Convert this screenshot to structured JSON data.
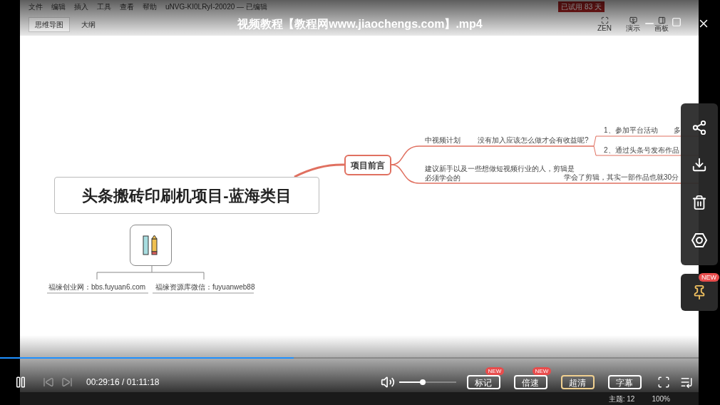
{
  "app": {
    "menu": [
      "文件",
      "编辑",
      "插入",
      "工具",
      "查看",
      "帮助"
    ],
    "doc_title": "uNVG-KI0LRyI-20020 — 已编辑",
    "trial": "已试用 83 天",
    "view_tabs": [
      {
        "label": "思维导图",
        "selected": true
      },
      {
        "label": "大纲",
        "selected": false
      }
    ],
    "toolbar": [
      "ZEN",
      "演示",
      "画板"
    ],
    "status": [
      "主题: 12",
      "100%"
    ]
  },
  "mindmap": {
    "root": "头条搬砖印刷机项目-蓝海类目",
    "topic": "项目前言",
    "branch_texts": [
      "中视频计划",
      "没有加入应该怎么做才会有收益呢?",
      "1、参加平台活动",
      "多",
      "2、通过头条号发布作品",
      "建议新手以及一些想做短视频行业的人，剪辑是",
      "必须学会的",
      "学会了剪辑，其实一部作品也就30分"
    ],
    "labels": [
      "福缘创业网：bbs.fuyuan6.com",
      "福缘资源库微信：fuyuanweb88"
    ]
  },
  "player": {
    "title": "视频教程【教程网www.jiaochengs.com】.mp4",
    "time": "00:29:16 / 01:11:18",
    "playing": true,
    "progress": {
      "level": 0.42
    },
    "volume": {
      "level": 0.42
    },
    "buttons": [
      {
        "label": "标记",
        "badge": "NEW",
        "highlight": false
      },
      {
        "label": "倍速",
        "badge": "NEW",
        "highlight": false
      },
      {
        "label": "超清",
        "highlight": true
      },
      {
        "label": "字幕",
        "highlight": false
      }
    ],
    "pin_badge": "NEW"
  }
}
